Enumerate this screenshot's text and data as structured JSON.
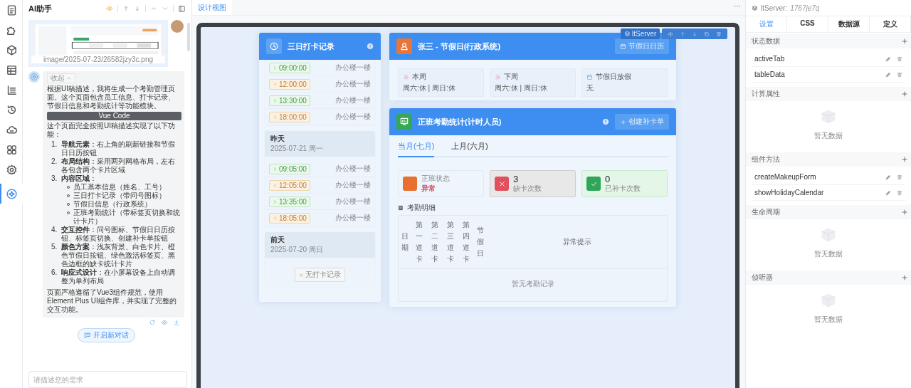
{
  "rail": [
    {
      "selected": false
    },
    {
      "selected": false
    },
    {
      "selected": false
    },
    {
      "selected": false
    },
    {
      "selected": false
    },
    {
      "selected": false
    },
    {
      "selected": false
    },
    {
      "selected": false
    },
    {
      "selected": false
    },
    {
      "selected": true
    }
  ],
  "assistant": {
    "title": "AI助手",
    "attachment": {
      "kind": "picture",
      "caption": "image/2025-07-23/26582jzy3c.png"
    },
    "reply": {
      "collapse": "收起",
      "intro": "根据UI稿描述，我将生成一个考勤管理页面。这个页面包含员工信息、打卡记录、节假日信息和考勤统计等功能模块。",
      "code_label": "Vue Code",
      "summary": "这个页面完全按照UI稿描述实现了以下功能：",
      "points": [
        {
          "number": "1.",
          "text": "**导航元素**：右上角的刷新链接和节假日日历按钮"
        },
        {
          "number": "2.",
          "text": "**布局结构**：采用两列网格布局，左右各包含两个卡片区域"
        },
        {
          "number": "3.",
          "text": "**内容区域**：",
          "children": [
            "员工基本信息（姓名、工号）",
            "三日打卡记录（带问号图标）",
            "节假日信息（行政系统）",
            "正班考勤统计（带标签页切换和统计卡片）"
          ]
        },
        {
          "number": "4.",
          "text": "**交互控件**：问号图标、节假日日历按钮、标签页切换、创建补卡单按钮"
        },
        {
          "number": "5.",
          "text": "**颜色方案**：浅灰背景、白色卡片、橙色节假日按钮、绿色激活标签页、黑色边框的缺卡统计卡片"
        },
        {
          "number": "6.",
          "text": "**响应式设计**：在小屏幕设备上自动调整为单列布局"
        }
      ],
      "closing": "页面严格遵循了Vue3组件规范，使用Element Plus UI组件库，并实现了完整的交互功能。"
    },
    "new_chat": "开启新对话",
    "input": {
      "placeholder": "请描述您的需求"
    }
  },
  "editor": {
    "tabs": [
      {
        "label": "设计视图",
        "selected": true
      }
    ],
    "more": "···",
    "checkin_card": {
      "title": "三日打卡记录",
      "days": [
        {
          "records": [
            {
              "kind": "in",
              "time": "09:00:00",
              "place": "办公楼一楼"
            },
            {
              "kind": "out",
              "time": "12:00:00",
              "place": "办公楼一楼"
            },
            {
              "kind": "in",
              "time": "13:30:00",
              "place": "办公楼一楼"
            },
            {
              "kind": "out",
              "time": "18:00:00",
              "place": "办公楼一楼"
            }
          ]
        },
        {
          "label": "昨天",
          "date": "2025-07-21 周一",
          "records": [
            {
              "kind": "in",
              "time": "09:05:00",
              "place": "办公楼一楼"
            },
            {
              "kind": "out",
              "time": "12:05:00",
              "place": "办公楼一楼"
            },
            {
              "kind": "in",
              "time": "13:35:00",
              "place": "办公楼一楼"
            },
            {
              "kind": "out",
              "time": "18:05:00",
              "place": "办公楼一楼"
            }
          ]
        },
        {
          "label": "前天",
          "date": "2025-07-20 周日",
          "empty": "无打卡记录"
        }
      ]
    },
    "holiday_card": {
      "title": "张三 - 节假日(行政系统)",
      "button": "节假日日历",
      "items": [
        {
          "kind": "week",
          "label": "本周",
          "value": "周六:休 | 周日:休"
        },
        {
          "kind": "week",
          "label": "下周",
          "value": "周六:休 | 周日:休"
        },
        {
          "kind": "holiday",
          "label": "节假日放假",
          "value": "无"
        }
      ]
    },
    "selection": {
      "label": "ltServer"
    },
    "stats_card": {
      "title": "正班考勤统计(计时人员)",
      "button": "创建补卡单",
      "tabs": [
        {
          "label": "当月(七月)",
          "selected": true
        },
        {
          "label": "上月(六月)",
          "selected": false
        }
      ],
      "tiles": [
        {
          "kind": "status",
          "label": "正班状态",
          "value": "异常"
        },
        {
          "kind": "missing",
          "value": "3",
          "label": "缺卡次数"
        },
        {
          "kind": "done",
          "value": "0",
          "label": "已补卡次数"
        }
      ],
      "detail_title": "考勤明细",
      "columns": [
        "日期",
        "第一道卡",
        "第二道卡",
        "第三道卡",
        "第四道卡",
        "节假日",
        "异常提示"
      ],
      "empty": "暂无考勤记录"
    }
  },
  "inspector": {
    "component": "ltServer:",
    "id": "1767je7q",
    "tabs": [
      {
        "label": "设置",
        "selected": true
      },
      {
        "label": "CSS",
        "selected": false
      },
      {
        "label": "数据源",
        "selected": false
      },
      {
        "label": "定义",
        "selected": false
      }
    ],
    "sections": [
      {
        "title": "状态数据",
        "items": [
          "activeTab",
          "tableData"
        ]
      },
      {
        "title": "计算属性",
        "empty": "暂无数据"
      },
      {
        "title": "组件方法",
        "items": [
          "createMakeupForm",
          "showHolidayCalendar"
        ]
      },
      {
        "title": "生命周期",
        "empty": "暂无数据"
      },
      {
        "title": "侦听器",
        "empty": "暂无数据"
      }
    ]
  }
}
